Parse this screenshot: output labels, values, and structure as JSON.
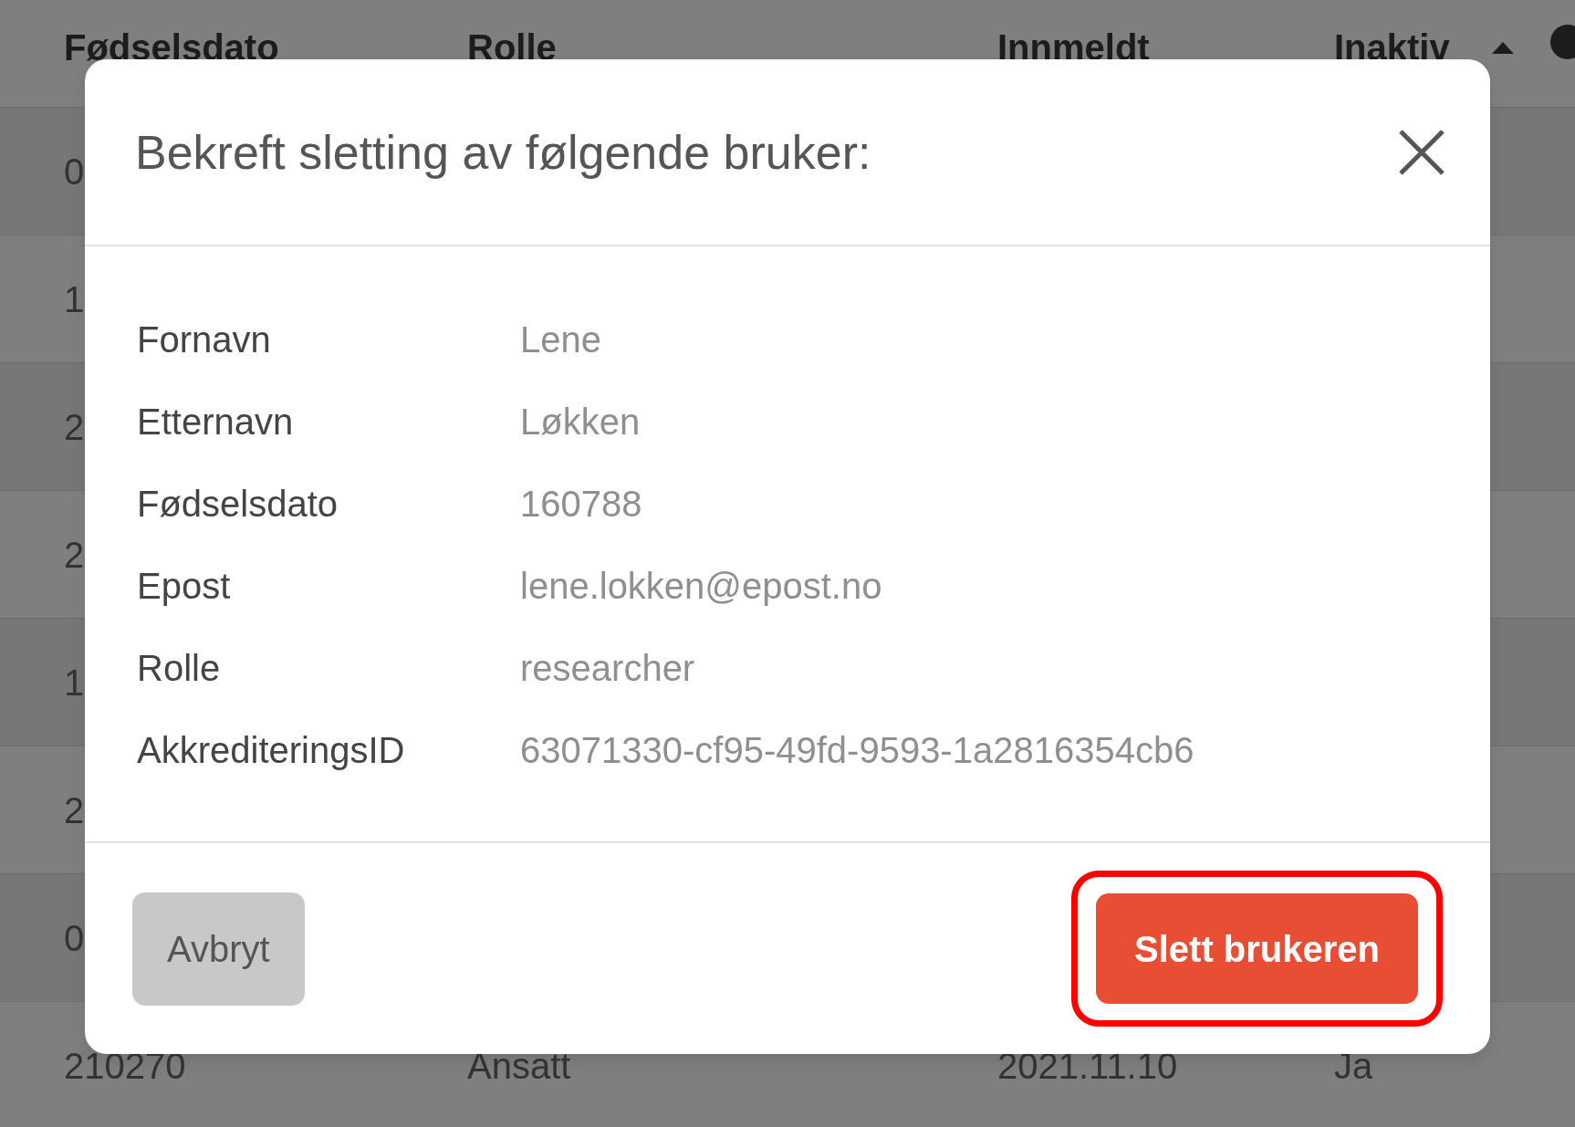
{
  "table": {
    "columns": [
      {
        "label": "Fødselsdato",
        "sorted": false
      },
      {
        "label": "Rolle",
        "sorted": false
      },
      {
        "label": "Innmeldt",
        "sorted": false
      },
      {
        "label": "Inaktiv",
        "sorted": true
      }
    ],
    "rows": [
      {
        "cells": [
          "0"
        ]
      },
      {
        "cells": [
          "1"
        ]
      },
      {
        "cells": [
          "2"
        ]
      },
      {
        "cells": [
          "2"
        ]
      },
      {
        "cells": [
          "1"
        ]
      },
      {
        "cells": [
          "2"
        ]
      },
      {
        "cells": [
          "0"
        ]
      },
      {
        "cells": [
          "210270",
          "Ansatt",
          "2021.11.10",
          "Ja"
        ]
      }
    ]
  },
  "dialog": {
    "title": "Bekreft sletting av følgende bruker:",
    "fields": [
      {
        "label": "Fornavn",
        "value": "Lene"
      },
      {
        "label": "Etternavn",
        "value": "Løkken"
      },
      {
        "label": "Fødselsdato",
        "value": "160788"
      },
      {
        "label": "Epost",
        "value": "lene.lokken@epost.no"
      },
      {
        "label": "Rolle",
        "value": "researcher"
      },
      {
        "label": "AkkrediteringsID",
        "value": "63071330-cf95-49fd-9593-1a2816354cb6"
      }
    ],
    "buttons": [
      {
        "label": "Avbryt",
        "kind": "secondary",
        "highlighted": false
      },
      {
        "label": "Slett brukeren",
        "kind": "danger",
        "highlighted": true
      }
    ]
  }
}
